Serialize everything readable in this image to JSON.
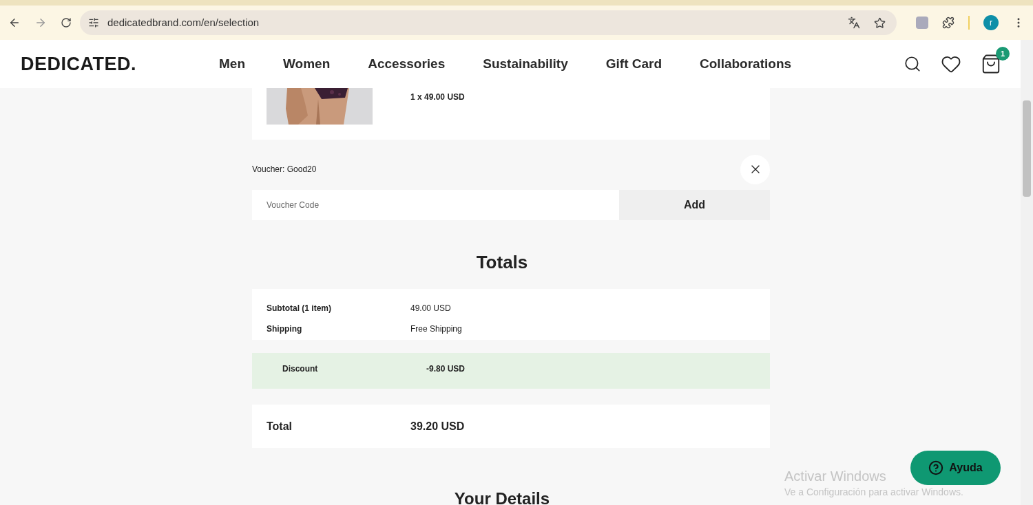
{
  "browser": {
    "url": "dedicatedbrand.com/en/selection",
    "profile_initial": "r"
  },
  "header": {
    "logo": "DEDICATED.",
    "nav": [
      {
        "label": "Men"
      },
      {
        "label": "Women"
      },
      {
        "label": "Accessories"
      },
      {
        "label": "Sustainability"
      },
      {
        "label": "Gift Card"
      },
      {
        "label": "Collaborations"
      }
    ],
    "cart_count": "1"
  },
  "cart_item": {
    "price_line": "1 x 49.00 USD"
  },
  "voucher": {
    "applied": "Voucher: Good20",
    "placeholder": "Voucher Code",
    "button": "Add"
  },
  "totals": {
    "title": "Totals",
    "rows": [
      {
        "label": "Subtotal (1 item)",
        "value": "49.00 USD"
      },
      {
        "label": "Shipping",
        "value": "Free Shipping"
      }
    ],
    "discount": {
      "label": "Discount",
      "value": "-9.80 USD"
    },
    "total": {
      "label": "Total",
      "value": "39.20 USD"
    }
  },
  "next_section": {
    "title": "Your Details"
  },
  "help_button": {
    "label": "Ayuda"
  },
  "os_notice": {
    "title": "Activar Windows",
    "text": "Ve a Configuración para activar Windows."
  }
}
